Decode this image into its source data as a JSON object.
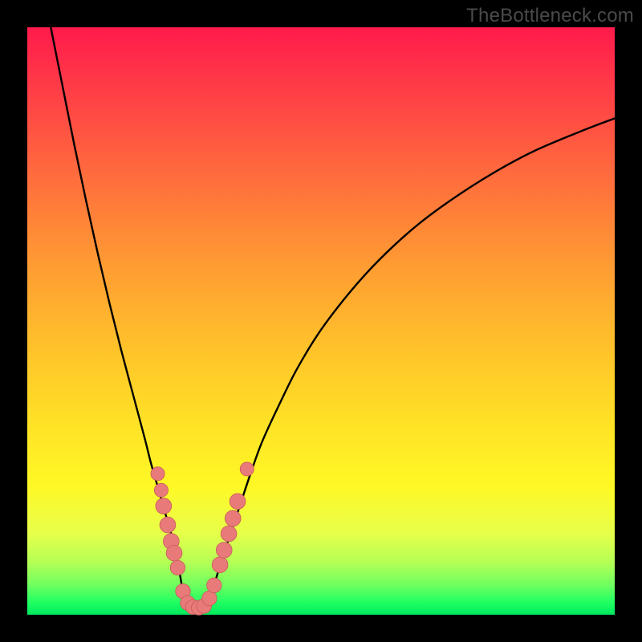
{
  "watermark": "TheBottleneck.com",
  "colors": {
    "frame": "#000000",
    "curve_stroke": "#000000",
    "marker_fill": "#e97a7a",
    "marker_stroke": "#c85a5a",
    "gradient_top": "#ff1a4b",
    "gradient_bottom": "#00e85e"
  },
  "chart_data": {
    "type": "line",
    "title": "",
    "xlabel": "",
    "ylabel": "",
    "xlim": [
      0,
      100
    ],
    "ylim": [
      0,
      100
    ],
    "grid": false,
    "legend": false,
    "series": [
      {
        "name": "left-branch",
        "x": [
          4,
          6,
          8,
          10,
          12,
          14,
          16,
          18,
          20,
          21,
          22,
          23,
          24,
          25,
          25.7,
          26.3
        ],
        "y": [
          100,
          90,
          80,
          70.5,
          61.5,
          53,
          45,
          37.5,
          30,
          26,
          22.5,
          19,
          15.5,
          12,
          8.5,
          5
        ]
      },
      {
        "name": "valley",
        "x": [
          26.3,
          27,
          28,
          29,
          30,
          31,
          31.8
        ],
        "y": [
          5,
          2.5,
          1.3,
          1.0,
          1.3,
          2.5,
          5
        ]
      },
      {
        "name": "right-branch",
        "x": [
          31.8,
          33,
          34.5,
          36,
          38,
          40,
          43,
          46,
          50,
          55,
          60,
          66,
          72,
          79,
          86,
          94,
          100
        ],
        "y": [
          5,
          9,
          13.5,
          18,
          24,
          29.5,
          36,
          42,
          48.5,
          55,
          60.5,
          66,
          70.5,
          75,
          78.8,
          82.2,
          84.5
        ]
      }
    ],
    "markers": [
      {
        "x": 22.2,
        "y": 24.0,
        "r": 1.3
      },
      {
        "x": 22.8,
        "y": 21.2,
        "r": 1.3
      },
      {
        "x": 23.2,
        "y": 18.5,
        "r": 1.5
      },
      {
        "x": 23.9,
        "y": 15.3,
        "r": 1.5
      },
      {
        "x": 24.5,
        "y": 12.5,
        "r": 1.5
      },
      {
        "x": 25.0,
        "y": 10.5,
        "r": 1.5
      },
      {
        "x": 25.6,
        "y": 8.0,
        "r": 1.4
      },
      {
        "x": 26.5,
        "y": 4.0,
        "r": 1.4
      },
      {
        "x": 27.3,
        "y": 2.0,
        "r": 1.4
      },
      {
        "x": 28.2,
        "y": 1.3,
        "r": 1.4
      },
      {
        "x": 29.2,
        "y": 1.2,
        "r": 1.4
      },
      {
        "x": 30.1,
        "y": 1.5,
        "r": 1.4
      },
      {
        "x": 31.0,
        "y": 2.8,
        "r": 1.4
      },
      {
        "x": 31.8,
        "y": 5.0,
        "r": 1.4
      },
      {
        "x": 32.8,
        "y": 8.5,
        "r": 1.5
      },
      {
        "x": 33.5,
        "y": 11.0,
        "r": 1.5
      },
      {
        "x": 34.3,
        "y": 13.8,
        "r": 1.5
      },
      {
        "x": 35.0,
        "y": 16.4,
        "r": 1.5
      },
      {
        "x": 35.8,
        "y": 19.3,
        "r": 1.5
      },
      {
        "x": 37.4,
        "y": 24.8,
        "r": 1.3
      }
    ]
  }
}
